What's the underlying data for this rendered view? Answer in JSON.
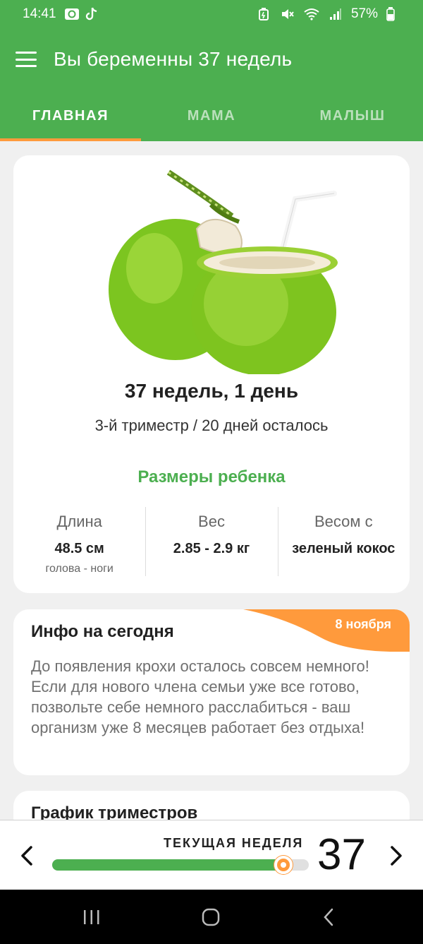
{
  "status_bar": {
    "time": "14:41",
    "battery": "57%",
    "icons": [
      "screen-record-icon",
      "tiktok-icon",
      "battery-saver-icon",
      "mute-icon",
      "wifi-icon",
      "signal-icon",
      "battery-icon"
    ]
  },
  "app_bar": {
    "title": "Вы беременны 37 недель",
    "menu_icon": "menu-icon"
  },
  "tabs": [
    {
      "label": "ГЛАВНАЯ",
      "active": true
    },
    {
      "label": "МАМА",
      "active": false
    },
    {
      "label": "МАЛЫШ",
      "active": false
    }
  ],
  "week_card": {
    "image": "green-coconut-illustration",
    "title": "37 недель, 1 день",
    "subtitle": "3-й триместр / 20 дней осталось",
    "sizes_title": "Размеры ребенка",
    "metrics": [
      {
        "label": "Длина",
        "value": "48.5 см",
        "note": "голова - ноги"
      },
      {
        "label": "Вес",
        "value": "2.85 - 2.9 кг",
        "note": ""
      },
      {
        "label": "Весом с",
        "value": "зеленый кокос",
        "note": ""
      }
    ]
  },
  "info_card": {
    "title": "Инфо на сегодня",
    "date": "8 ноября",
    "text": "До появления крохи осталось совсем немного! Если для нового члена семьи уже все готово, позвольте себе немного расслабиться - ваш организм уже 8 месяцев работает без отдыха!"
  },
  "trimester_card": {
    "title": "График триместров"
  },
  "week_selector": {
    "label": "ТЕКУЩАЯ НЕДЕЛЯ",
    "week": "37",
    "progress": 0.9,
    "prev_icon": "chevron-left-icon",
    "next_icon": "chevron-right-icon"
  },
  "colors": {
    "primary": "#4caf50",
    "accent": "#ff9a3c",
    "background": "#f0f0f0"
  }
}
